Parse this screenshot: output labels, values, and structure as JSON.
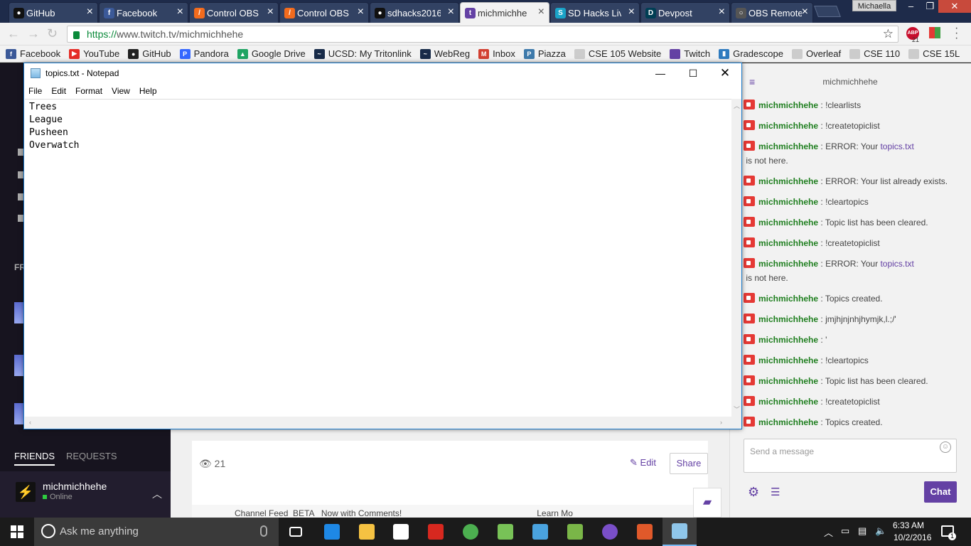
{
  "browser": {
    "tabs": [
      {
        "label": "GitHub",
        "icon": "github-icon",
        "color": "#111111"
      },
      {
        "label": "Facebook",
        "icon": "facebook-icon",
        "color": "#3b5998"
      },
      {
        "label": "Control OBS",
        "icon": "obs-remote-icon",
        "color": "#f26b1d"
      },
      {
        "label": "Control OBS",
        "icon": "obs-remote-icon",
        "color": "#f26b1d"
      },
      {
        "label": "sdhacks2016",
        "icon": "github-icon",
        "color": "#111111"
      },
      {
        "label": "michmichhe",
        "icon": "twitch-icon",
        "color": "#6441a4"
      },
      {
        "label": "SD Hacks Liv",
        "icon": "sdhacks-icon",
        "color": "#1aa3c8"
      },
      {
        "label": "Devpost",
        "icon": "devpost-icon",
        "color": "#003e54"
      },
      {
        "label": "OBS Remote",
        "icon": "obs-icon",
        "color": "#555555"
      }
    ],
    "profile_name": "Michaella",
    "url_scheme": "https://",
    "url_rest": "www.twitch.tv/michmichhehe",
    "abp_label": "ABP",
    "abp_count": "21",
    "bookmarks": [
      {
        "label": "Facebook",
        "color": "#3b5998",
        "glyph": "f"
      },
      {
        "label": "YouTube",
        "color": "#e52d27",
        "glyph": "▶"
      },
      {
        "label": "GitHub",
        "color": "#222222",
        "glyph": "●"
      },
      {
        "label": "Pandora",
        "color": "#3668ff",
        "glyph": "P"
      },
      {
        "label": "Google Drive",
        "color": "#1fa463",
        "glyph": "▲"
      },
      {
        "label": "UCSD: My Tritonlink",
        "color": "#182b49",
        "glyph": "~"
      },
      {
        "label": "WebReg",
        "color": "#182b49",
        "glyph": "~"
      },
      {
        "label": "Inbox",
        "color": "#d23f31",
        "glyph": "M"
      },
      {
        "label": "Piazza",
        "color": "#3e7aab",
        "glyph": "P"
      },
      {
        "label": "CSE 105 Website",
        "color": "#cccccc",
        "glyph": ""
      },
      {
        "label": "Twitch",
        "color": "#6441a4",
        "glyph": ""
      },
      {
        "label": "Gradescope",
        "color": "#2f7bbf",
        "glyph": "▮"
      },
      {
        "label": "Overleaf",
        "color": "#cccccc",
        "glyph": ""
      },
      {
        "label": "CSE 110",
        "color": "#cccccc",
        "glyph": ""
      },
      {
        "label": "CSE 15L",
        "color": "#cccccc",
        "glyph": ""
      }
    ]
  },
  "twitch": {
    "sidebar_fr": "FR",
    "friends_tab": "FRIENDS",
    "requests_tab": "REQUESTS",
    "friend": {
      "name": "michmichhehe",
      "status": "Online"
    },
    "views": "21",
    "edit_label": "Edit",
    "share_label": "Share",
    "feed_text": "Channel Feed  BETA   Now with Comments!                                                         Learn Mo"
  },
  "chat": {
    "title": "michmichhehe",
    "input_placeholder": "Send a message",
    "send_label": "Chat",
    "messages": [
      {
        "user": "michmichhehe",
        "sep": ":",
        "text": "!clearlists"
      },
      {
        "user": "michmichhehe",
        "sep": ":",
        "text": "!createtopiclist"
      },
      {
        "user": "michmichhehe",
        "sep": ":",
        "pre": "ERROR: Your ",
        "link": "topics.txt",
        "post": " is not here."
      },
      {
        "user": "michmichhehe",
        "sep": ":",
        "text": "ERROR: Your list already exists."
      },
      {
        "user": "michmichhehe",
        "sep": ":",
        "text": "!cleartopics"
      },
      {
        "user": "michmichhehe",
        "sep": ":",
        "text": "Topic list has been cleared."
      },
      {
        "user": "michmichhehe",
        "sep": ":",
        "text": "!createtopiclist"
      },
      {
        "user": "michmichhehe",
        "sep": ":",
        "pre": "ERROR: Your ",
        "link": "topics.txt",
        "post": " is not here."
      },
      {
        "user": "michmichhehe",
        "sep": ":",
        "text": "Topics created."
      },
      {
        "user": "michmichhehe",
        "sep": ":",
        "text": "jmjhjnjnhjhymjk,l.;/'"
      },
      {
        "user": "michmichhehe",
        "sep": ":",
        "text": "'"
      },
      {
        "user": "michmichhehe",
        "sep": ":",
        "text": "!cleartopics"
      },
      {
        "user": "michmichhehe",
        "sep": ":",
        "text": "Topic list has been cleared."
      },
      {
        "user": "michmichhehe",
        "sep": ":",
        "text": "!createtopiclist"
      },
      {
        "user": "michmichhehe",
        "sep": ":",
        "text": "Topics created."
      }
    ]
  },
  "notepad": {
    "title": "topics.txt - Notepad",
    "menus": [
      "File",
      "Edit",
      "Format",
      "View",
      "Help"
    ],
    "lines": [
      "Trees",
      "League",
      "Pusheen",
      "Overwatch"
    ]
  },
  "taskbar": {
    "search_placeholder": "Ask me anything",
    "time": "6:33 AM",
    "date": "10/2/2016",
    "notification_count": "1",
    "apps": [
      {
        "name": "task-view-icon",
        "color": "#ffffff"
      },
      {
        "name": "edge-icon",
        "color": "#1e88e5"
      },
      {
        "name": "file-explorer-icon",
        "color": "#f5c242"
      },
      {
        "name": "store-icon",
        "color": "#ffffff"
      },
      {
        "name": "acrobat-icon",
        "color": "#d7281f"
      },
      {
        "name": "chrome-icon",
        "color": "#4caf50"
      },
      {
        "name": "android-studio-icon",
        "color": "#78c257"
      },
      {
        "name": "remote-desktop-icon",
        "color": "#4aa3df"
      },
      {
        "name": "spreadsheet-icon",
        "color": "#7ab648"
      },
      {
        "name": "obs-app-icon",
        "color": "#7a4fc8"
      },
      {
        "name": "game-icon",
        "color": "#e0592a"
      },
      {
        "name": "notepad-icon",
        "color": "#8fc6ea"
      }
    ]
  }
}
